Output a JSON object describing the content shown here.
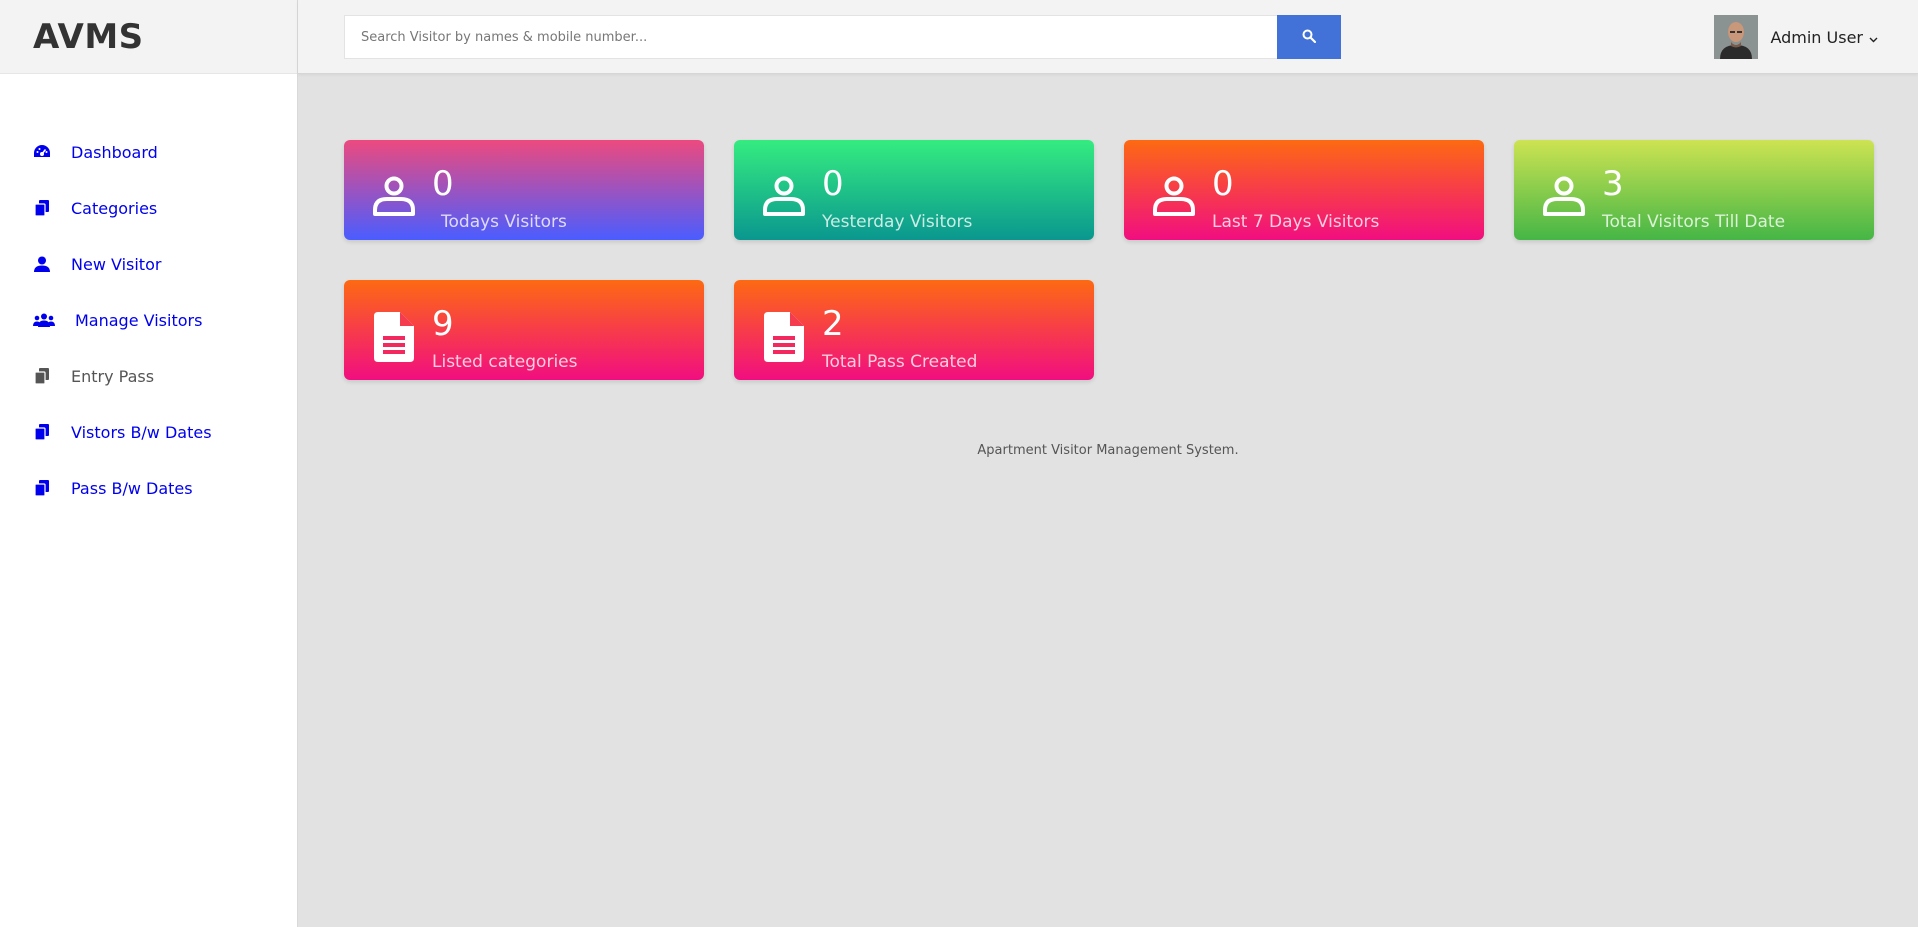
{
  "brand": {
    "title": "AVMS"
  },
  "sidebar": {
    "items": [
      {
        "label": "Dashboard",
        "icon": "dashboard-gauge-icon"
      },
      {
        "label": "Categories",
        "icon": "copy-files-icon"
      },
      {
        "label": "New Visitor",
        "icon": "user-icon"
      },
      {
        "label": "Manage Visitors",
        "icon": "users-group-icon"
      },
      {
        "label": "Entry Pass",
        "icon": "copy-files-icon"
      },
      {
        "label": "Vistors B/w Dates",
        "icon": "copy-files-icon"
      },
      {
        "label": "Pass B/w Dates",
        "icon": "copy-files-icon"
      }
    ]
  },
  "topbar": {
    "search_placeholder": "Search Visitor by names & mobile number...",
    "search_icon": "search-icon",
    "user_name": "Admin User",
    "user_chevron": "chevron-down-icon"
  },
  "cards": [
    {
      "value": "0",
      "label": "Todays Visitors",
      "icon": "user-icon"
    },
    {
      "value": "0",
      "label": "Yesterday Visitors",
      "icon": "user-icon"
    },
    {
      "value": "0",
      "label": "Last 7 Days Visitors",
      "icon": "user-icon"
    },
    {
      "value": "3",
      "label": "Total Visitors Till Date",
      "icon": "user-icon"
    },
    {
      "value": "9",
      "label": "Listed categories",
      "icon": "file-icon"
    },
    {
      "value": "2",
      "label": "Total Pass Created",
      "icon": "file-icon"
    }
  ],
  "footer": {
    "text": "Apartment Visitor Management System."
  },
  "colors": {
    "link": "#0000ee",
    "search_button": "#4272d7",
    "content_bg": "#e2e2e2"
  }
}
